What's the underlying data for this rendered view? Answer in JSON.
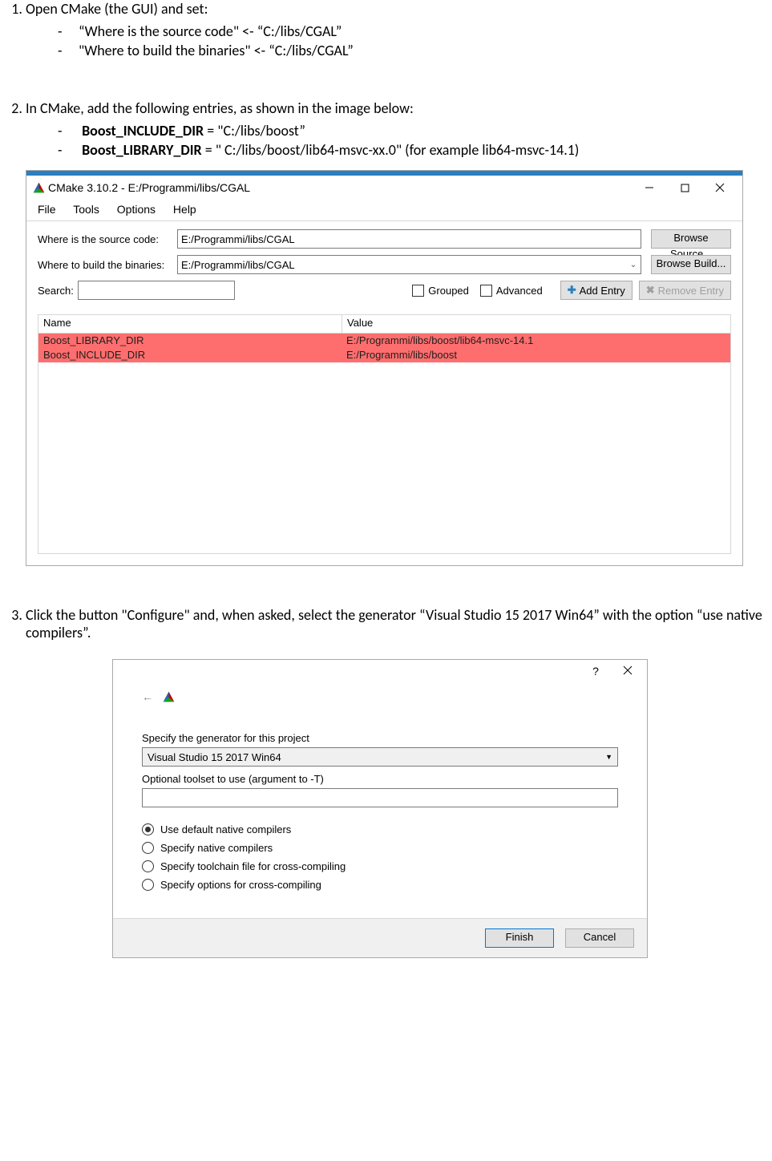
{
  "doc": {
    "step1": {
      "intro": "Open CMake (the GUI) and set:",
      "item1": "“Where is the source code\" <- “C:/libs/CGAL”",
      "item2": "\"Where to build the binaries\" <- “C:/libs/CGAL”"
    },
    "step2": {
      "intro": "In CMake, add the following entries, as shown in the image below:",
      "item1_key": "Boost_INCLUDE_DIR",
      "item1_val": " = \"C:/libs/boost”",
      "item2_key": "Boost_LIBRARY_DIR",
      "item2_val": " = \" C:/libs/boost/lib64-msvc-xx.0\" (for example lib64-msvc-14.1)"
    },
    "step3": {
      "text": "Click the button \"Configure\" and, when asked, select the generator “Visual Studio 15 2017 Win64” with the option “use native compilers”."
    }
  },
  "cmake": {
    "title": "CMake 3.10.2 - E:/Programmi/libs/CGAL",
    "menu": {
      "file": "File",
      "tools": "Tools",
      "options": "Options",
      "help": "Help"
    },
    "source_label": "Where is the source code:",
    "source_value": "E:/Programmi/libs/CGAL",
    "browse_source": "Browse Source...",
    "build_label": "Where to build the binaries:",
    "build_value": "E:/Programmi/libs/CGAL",
    "browse_build": "Browse Build...",
    "search_label": "Search:",
    "grouped": "Grouped",
    "advanced": "Advanced",
    "add_entry": "Add Entry",
    "remove_entry": "Remove Entry",
    "col_name": "Name",
    "col_value": "Value",
    "rows": {
      "r0": {
        "name": "Boost_LIBRARY_DIR",
        "value": "E:/Programmi/libs/boost/lib64-msvc-14.1"
      },
      "r1": {
        "name": "Boost_INCLUDE_DIR",
        "value": "E:/Programmi/libs/boost"
      }
    }
  },
  "gen": {
    "label_generator": "Specify the generator for this project",
    "generator_value": "Visual Studio 15 2017 Win64",
    "label_toolset": "Optional toolset to use (argument to -T)",
    "opt0": "Use default native compilers",
    "opt1": "Specify native compilers",
    "opt2": "Specify toolchain file for cross-compiling",
    "opt3": "Specify options for cross-compiling",
    "finish": "Finish",
    "cancel": "Cancel"
  }
}
